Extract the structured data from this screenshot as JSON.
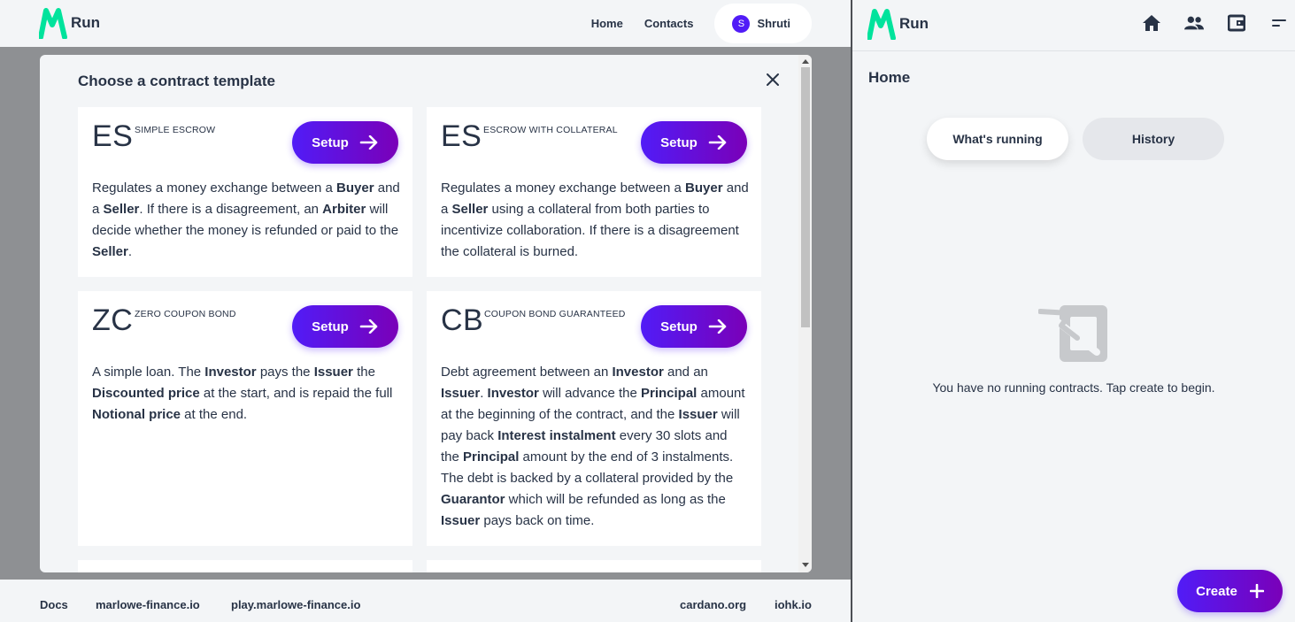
{
  "app": {
    "logo_text": "Run",
    "brand_colors": {
      "primary": "#511cf7",
      "secondary": "#7a00b8",
      "logo_green": "#00e39c"
    }
  },
  "topnav": {
    "home": "Home",
    "contacts": "Contacts",
    "user_initial": "S",
    "user_name": "Shruti"
  },
  "modal": {
    "title": "Choose a contract template",
    "setup_label": "Setup",
    "cards": [
      {
        "abbr": "ES",
        "name": "Simple Escrow",
        "description": [
          "Regulates a money exchange between a ",
          {
            "b": "Buyer"
          },
          " and a ",
          {
            "b": "Seller"
          },
          ". If there is a disagreement, an ",
          {
            "b": "Arbiter"
          },
          " will decide whether the money is refunded or paid to the ",
          {
            "b": "Seller"
          },
          "."
        ]
      },
      {
        "abbr": "ES",
        "name": "Escrow with collateral",
        "description": [
          "Regulates a money exchange between a ",
          {
            "b": "Buyer"
          },
          " and a ",
          {
            "b": "Seller"
          },
          " using a collateral from both parties to incentivize collaboration. If there is a disagreement the collateral is burned."
        ]
      },
      {
        "abbr": "ZC",
        "name": "Zero coupon bond",
        "description": [
          "A simple loan. The ",
          {
            "b": "Investor"
          },
          " pays the ",
          {
            "b": "Issuer"
          },
          " the ",
          {
            "b": "Discounted price"
          },
          " at the start, and is repaid the full ",
          {
            "b": "Notional price"
          },
          " at the end."
        ]
      },
      {
        "abbr": "CB",
        "name": "Coupon bond guaranteed",
        "description": [
          "Debt agreement between an ",
          {
            "b": "Investor"
          },
          " and an ",
          {
            "b": "Issuer"
          },
          ". ",
          {
            "b": "Investor"
          },
          " will advance the ",
          {
            "b": "Principal"
          },
          " amount at the beginning of the contract, and the ",
          {
            "b": "Issuer"
          },
          " will pay back ",
          {
            "b": "Interest instalment"
          },
          " every 30 slots and the ",
          {
            "b": "Principal"
          },
          " amount by the end of 3 instalments. The debt is backed by a collateral provided by the ",
          {
            "b": "Guarantor"
          },
          " which will be refunded as long as the ",
          {
            "b": "Issuer"
          },
          " pays back on time."
        ]
      }
    ]
  },
  "footer": {
    "links": [
      "Docs",
      "marlowe-finance.io",
      "play.marlowe-finance.io",
      "cardano.org",
      "iohk.io"
    ]
  },
  "right_panel": {
    "title": "Home",
    "tabs": [
      "What's running",
      "History"
    ],
    "empty_message": "You have no running contracts. Tap create to begin.",
    "create_label": "Create",
    "icons": [
      "home-icon",
      "contacts-icon",
      "wallet-icon",
      "menu-icon"
    ]
  }
}
